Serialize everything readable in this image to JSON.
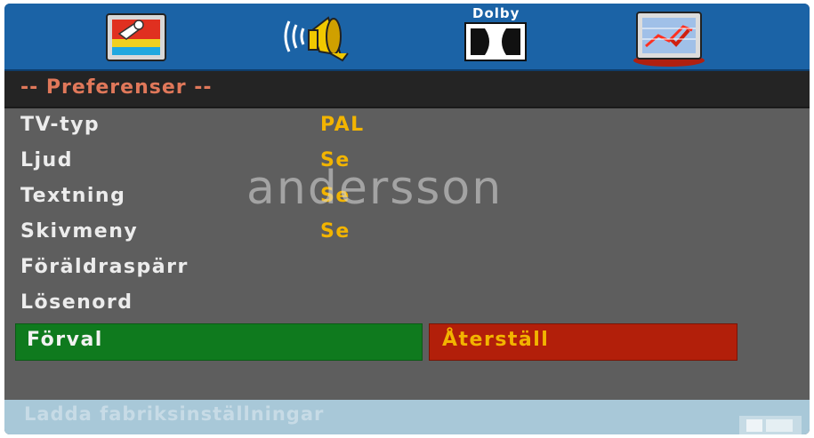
{
  "tabs": [
    {
      "name": "general-setup",
      "icon": "settings-picture-icon"
    },
    {
      "name": "audio-setup",
      "icon": "speaker-icon"
    },
    {
      "name": "dolby-setup",
      "icon": "dolby-icon",
      "label": "Dolby"
    },
    {
      "name": "preferences",
      "icon": "preferences-chart-icon",
      "selected": true
    }
  ],
  "section_title": "-- Preferenser --",
  "settings": [
    {
      "label": "TV-typ",
      "value": "PAL"
    },
    {
      "label": "Ljud",
      "value": "Se"
    },
    {
      "label": "Textning",
      "value": "Se"
    },
    {
      "label": "Skivmeny",
      "value": "Se"
    },
    {
      "label": "Föräldraspärr",
      "value": ""
    },
    {
      "label": "Lösenord",
      "value": ""
    }
  ],
  "actions": {
    "default_label": "Förval",
    "reset_label": "Återställ"
  },
  "watermark": "andersson",
  "status_text": "Ladda fabriksinställningar",
  "colors": {
    "tabbar": "#1b63a6",
    "background": "#5e5e5e",
    "title": "#e0785a",
    "value": "#f2b400",
    "default_button": "#0f7a1e",
    "reset_button": "#b21f0a",
    "status_bar": "#a8c8d8"
  }
}
